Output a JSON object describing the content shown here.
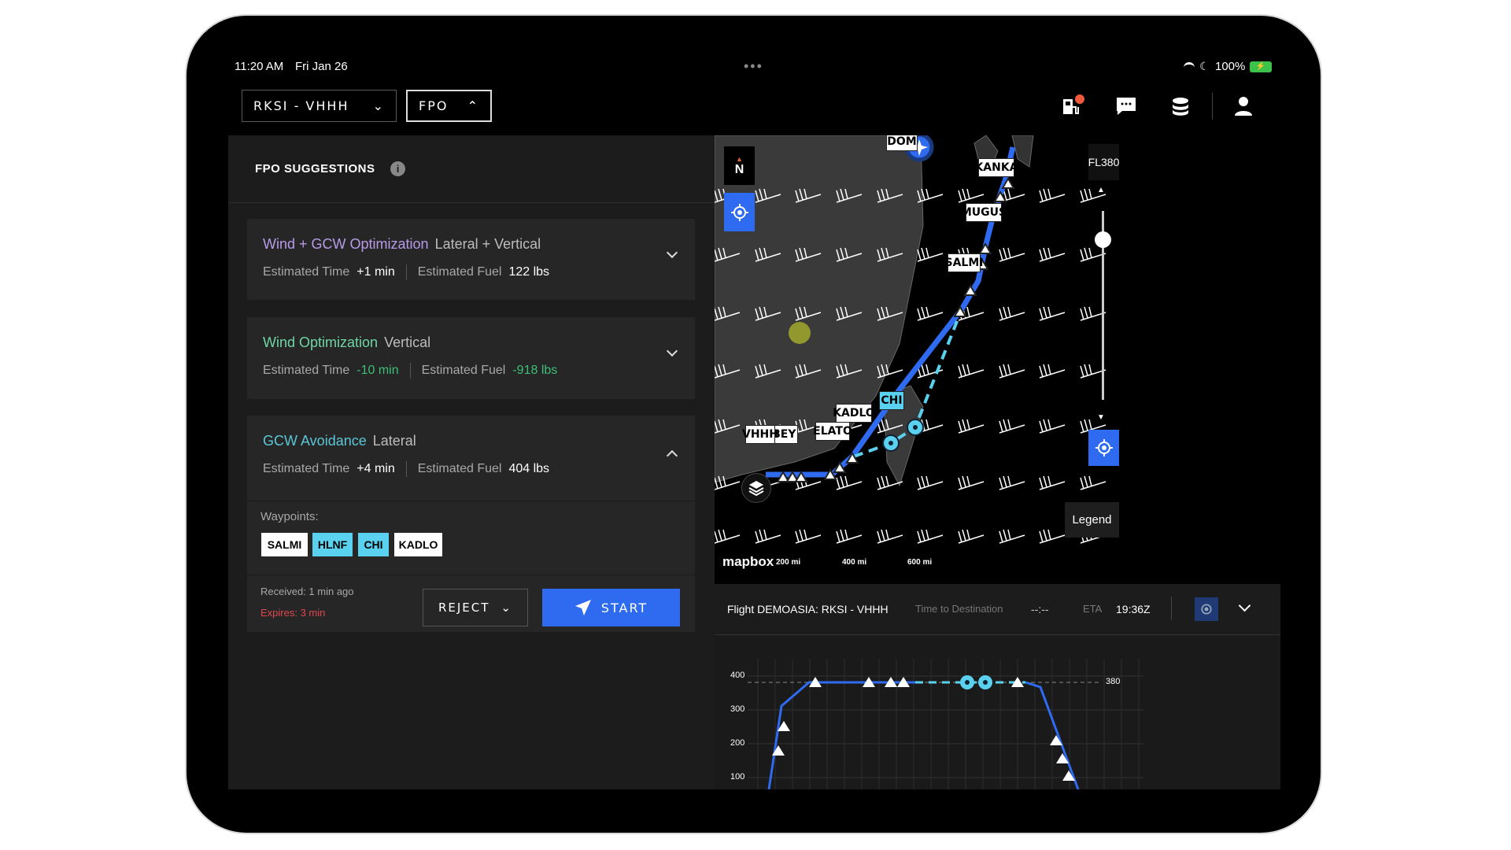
{
  "status_bar": {
    "time": "11:20 AM",
    "date": "Fri Jan 26",
    "battery": "100%"
  },
  "header": {
    "route_select": "RKSI - VHHH",
    "mode_select": "FPO",
    "icons": [
      "fuel-pump-icon",
      "chat-icon",
      "database-icon",
      "user-icon"
    ],
    "notification_color": "#f05a3c"
  },
  "panel": {
    "title": "FPO SUGGESTIONS",
    "suggestions": [
      {
        "title": "Wind + GCW Optimization",
        "type": "Lateral + Vertical",
        "time_label": "Estimated Time",
        "time": "+1 min",
        "fuel_label": "Estimated Fuel",
        "fuel": "122 lbs",
        "color": "#b79be8",
        "expanded": false
      },
      {
        "title": "Wind Optimization",
        "type": "Vertical",
        "time_label": "Estimated Time",
        "time": "-10 min",
        "fuel_label": "Estimated Fuel",
        "fuel": "-918 lbs",
        "color": "#6fd4a6",
        "value_color": "#3dbf78",
        "expanded": false
      },
      {
        "title": "GCW Avoidance",
        "type": "Lateral",
        "time_label": "Estimated Time",
        "time": "+4 min",
        "fuel_label": "Estimated Fuel",
        "fuel": "404 lbs",
        "color": "#5cc6d6",
        "expanded": true,
        "waypoints_label": "Waypoints:",
        "waypoints": [
          {
            "name": "SALMI",
            "new": false
          },
          {
            "name": "HLNF",
            "new": true
          },
          {
            "name": "CHI",
            "new": true
          },
          {
            "name": "KADLO",
            "new": false
          }
        ],
        "received": "Received: 1 min ago",
        "expires": "Expires: 3 min",
        "reject": "REJECT",
        "start": "START"
      }
    ]
  },
  "map": {
    "compass": "N",
    "flight_level": "FL380",
    "legend": "Legend",
    "attribution": "mapbox",
    "scale": [
      "200 mi",
      "400 mi",
      "600 mi"
    ],
    "waypoints": [
      "DOM",
      "KANKA",
      "MUGUS",
      "SALMI",
      "CHI",
      "KADLO",
      "ELATO",
      "VHHH",
      "BBEY"
    ]
  },
  "flight_bar": {
    "flight": "Flight DEMOASIA: RKSI - VHHH",
    "ttd_label": "Time to Destination",
    "ttd": "--:--",
    "eta_label": "ETA",
    "eta": "19:36Z"
  },
  "profile": {
    "y_ticks": [
      "400",
      "300",
      "200",
      "100"
    ],
    "cruise_level": "380"
  },
  "colors": {
    "accent": "#2f6bf0",
    "route": "#2f6bf0",
    "new_route": "#5ad2ef",
    "expires": "#e0474c"
  }
}
